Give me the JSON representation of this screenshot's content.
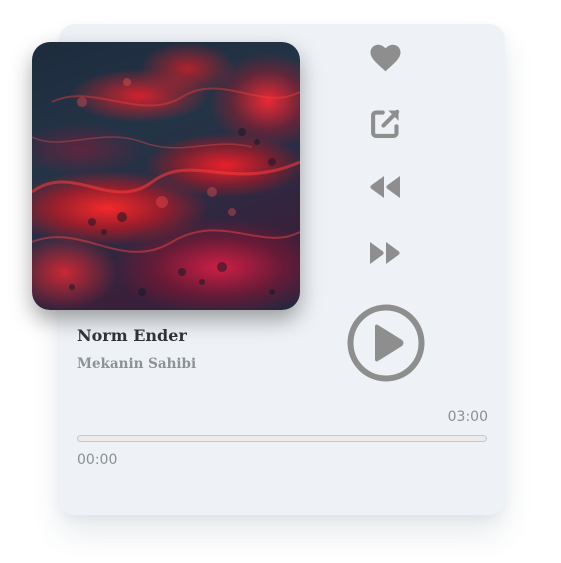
{
  "track": {
    "title": "Norm Ender",
    "artist": "Mekanin Sahibi"
  },
  "progress": {
    "current_time": "00:00",
    "total_time": "03:00",
    "fraction": 0
  },
  "controls": {
    "like_icon": "heart-icon",
    "share_icon": "external-link-icon",
    "rewind_icon": "rewind-icon",
    "forward_icon": "fast-forward-icon",
    "play_icon": "play-circle-icon"
  },
  "colors": {
    "card_background": "#eef2f6",
    "icon": "#8e8e8e",
    "title_text": "#2f3336",
    "muted_text": "#8d9296",
    "cover_red": "#e0141e",
    "cover_dark": "#1d2b3d"
  }
}
